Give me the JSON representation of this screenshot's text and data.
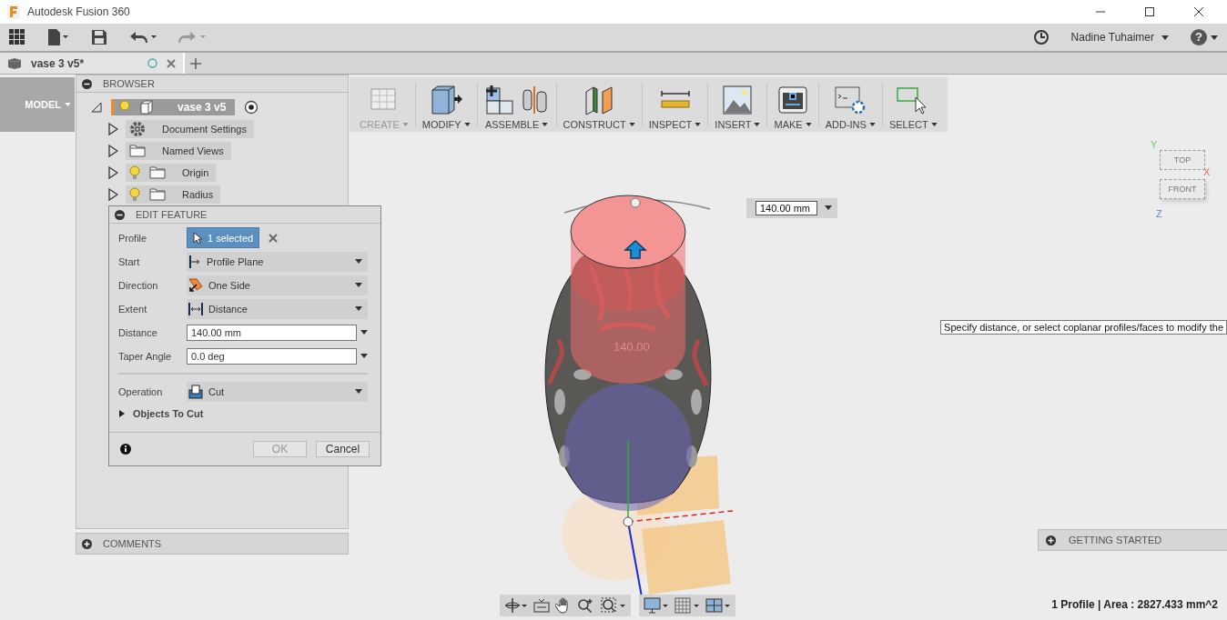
{
  "window": {
    "title": "Autodesk Fusion 360"
  },
  "quick_access": {
    "user_name": "Nadine Tuhaimer",
    "help_glyph": "?"
  },
  "document_tabs": [
    {
      "label": "vase 3 v5*",
      "selected": true
    }
  ],
  "workspace": {
    "label": "MODEL"
  },
  "ribbon": [
    {
      "label": "CREATE",
      "kind": "create"
    },
    {
      "label": "MODIFY",
      "kind": "modify"
    },
    {
      "label": "ASSEMBLE",
      "kind": "assemble"
    },
    {
      "label": "CONSTRUCT",
      "kind": "construct"
    },
    {
      "label": "INSPECT",
      "kind": "inspect"
    },
    {
      "label": "INSERT",
      "kind": "insert"
    },
    {
      "label": "MAKE",
      "kind": "make"
    },
    {
      "label": "ADD-INS",
      "kind": "addins"
    },
    {
      "label": "SELECT",
      "kind": "select"
    }
  ],
  "browser": {
    "title": "BROWSER",
    "root": {
      "label": "vase 3 v5",
      "expanded": true,
      "selected": true,
      "children": [
        {
          "label": "Document Settings",
          "kind": "settings",
          "expanded": false,
          "selected": false
        },
        {
          "label": "Named Views",
          "kind": "folder",
          "expanded": false,
          "selected": false
        },
        {
          "label": "Origin",
          "kind": "lightfolder",
          "expanded": false,
          "selected": false
        },
        {
          "label": "Radius",
          "kind": "lightfolder",
          "expanded": false,
          "selected": false
        }
      ]
    }
  },
  "edit_feature": {
    "title": "EDIT FEATURE",
    "rows": [
      {
        "label": "Profile",
        "kind": "selection",
        "value": "1 selected"
      },
      {
        "label": "Start",
        "kind": "dropdown",
        "value": "Profile Plane"
      },
      {
        "label": "Direction",
        "kind": "dropdown",
        "value": "One Side"
      },
      {
        "label": "Extent",
        "kind": "dropdown",
        "value": "Distance"
      },
      {
        "label": "Distance",
        "kind": "input",
        "value": "140.00 mm"
      },
      {
        "label": "Taper Angle",
        "kind": "input",
        "value": "0.0 deg"
      }
    ],
    "operation": {
      "label": "Operation",
      "value": "Cut"
    },
    "objects_to_cut": {
      "label": "Objects To Cut",
      "expanded": false
    },
    "buttons": [
      "OK",
      "Cancel"
    ]
  },
  "viewport": {
    "dimension_input": {
      "value": "140.00 mm"
    },
    "model_dimension": "140.00",
    "tooltip": "Specify distance, or select coplanar profiles/faces to modify the",
    "viewcube": {
      "top": "TOP",
      "front": "FRONT",
      "x": "X",
      "y": "Y",
      "z": "Z"
    }
  },
  "comments": {
    "title": "COMMENTS"
  },
  "getting_started": {
    "title": "GETTING STARTED"
  },
  "status_bar": {
    "text": "1 Profile | Area : 2827.433 mm^2"
  }
}
